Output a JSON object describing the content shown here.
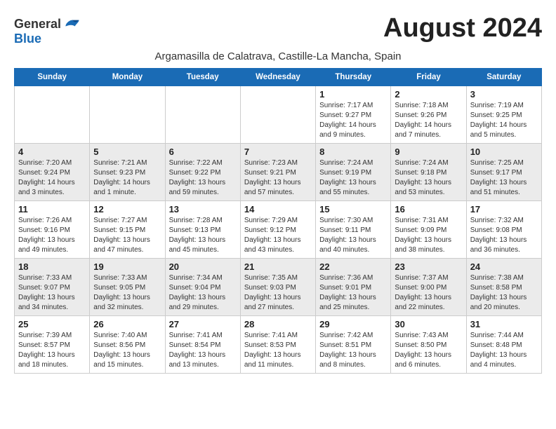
{
  "header": {
    "logo_general": "General",
    "logo_blue": "Blue",
    "title": "August 2024",
    "subtitle": "Argamasilla de Calatrava, Castille-La Mancha, Spain"
  },
  "days_of_week": [
    "Sunday",
    "Monday",
    "Tuesday",
    "Wednesday",
    "Thursday",
    "Friday",
    "Saturday"
  ],
  "weeks": [
    {
      "id": "week1",
      "cells": [
        {
          "day": "Sun",
          "date": "",
          "text": ""
        },
        {
          "day": "Mon",
          "date": "",
          "text": ""
        },
        {
          "day": "Tue",
          "date": "",
          "text": ""
        },
        {
          "day": "Wed",
          "date": "",
          "text": ""
        },
        {
          "day": "Thu",
          "date": "1",
          "text": "Sunrise: 7:17 AM\nSunset: 9:27 PM\nDaylight: 14 hours and 9 minutes."
        },
        {
          "day": "Fri",
          "date": "2",
          "text": "Sunrise: 7:18 AM\nSunset: 9:26 PM\nDaylight: 14 hours and 7 minutes."
        },
        {
          "day": "Sat",
          "date": "3",
          "text": "Sunrise: 7:19 AM\nSunset: 9:25 PM\nDaylight: 14 hours and 5 minutes."
        }
      ]
    },
    {
      "id": "week2",
      "cells": [
        {
          "day": "Sun",
          "date": "4",
          "text": "Sunrise: 7:20 AM\nSunset: 9:24 PM\nDaylight: 14 hours and 3 minutes."
        },
        {
          "day": "Mon",
          "date": "5",
          "text": "Sunrise: 7:21 AM\nSunset: 9:23 PM\nDaylight: 14 hours and 1 minute."
        },
        {
          "day": "Tue",
          "date": "6",
          "text": "Sunrise: 7:22 AM\nSunset: 9:22 PM\nDaylight: 13 hours and 59 minutes."
        },
        {
          "day": "Wed",
          "date": "7",
          "text": "Sunrise: 7:23 AM\nSunset: 9:21 PM\nDaylight: 13 hours and 57 minutes."
        },
        {
          "day": "Thu",
          "date": "8",
          "text": "Sunrise: 7:24 AM\nSunset: 9:19 PM\nDaylight: 13 hours and 55 minutes."
        },
        {
          "day": "Fri",
          "date": "9",
          "text": "Sunrise: 7:24 AM\nSunset: 9:18 PM\nDaylight: 13 hours and 53 minutes."
        },
        {
          "day": "Sat",
          "date": "10",
          "text": "Sunrise: 7:25 AM\nSunset: 9:17 PM\nDaylight: 13 hours and 51 minutes."
        }
      ]
    },
    {
      "id": "week3",
      "cells": [
        {
          "day": "Sun",
          "date": "11",
          "text": "Sunrise: 7:26 AM\nSunset: 9:16 PM\nDaylight: 13 hours and 49 minutes."
        },
        {
          "day": "Mon",
          "date": "12",
          "text": "Sunrise: 7:27 AM\nSunset: 9:15 PM\nDaylight: 13 hours and 47 minutes."
        },
        {
          "day": "Tue",
          "date": "13",
          "text": "Sunrise: 7:28 AM\nSunset: 9:13 PM\nDaylight: 13 hours and 45 minutes."
        },
        {
          "day": "Wed",
          "date": "14",
          "text": "Sunrise: 7:29 AM\nSunset: 9:12 PM\nDaylight: 13 hours and 43 minutes."
        },
        {
          "day": "Thu",
          "date": "15",
          "text": "Sunrise: 7:30 AM\nSunset: 9:11 PM\nDaylight: 13 hours and 40 minutes."
        },
        {
          "day": "Fri",
          "date": "16",
          "text": "Sunrise: 7:31 AM\nSunset: 9:09 PM\nDaylight: 13 hours and 38 minutes."
        },
        {
          "day": "Sat",
          "date": "17",
          "text": "Sunrise: 7:32 AM\nSunset: 9:08 PM\nDaylight: 13 hours and 36 minutes."
        }
      ]
    },
    {
      "id": "week4",
      "cells": [
        {
          "day": "Sun",
          "date": "18",
          "text": "Sunrise: 7:33 AM\nSunset: 9:07 PM\nDaylight: 13 hours and 34 minutes."
        },
        {
          "day": "Mon",
          "date": "19",
          "text": "Sunrise: 7:33 AM\nSunset: 9:05 PM\nDaylight: 13 hours and 32 minutes."
        },
        {
          "day": "Tue",
          "date": "20",
          "text": "Sunrise: 7:34 AM\nSunset: 9:04 PM\nDaylight: 13 hours and 29 minutes."
        },
        {
          "day": "Wed",
          "date": "21",
          "text": "Sunrise: 7:35 AM\nSunset: 9:03 PM\nDaylight: 13 hours and 27 minutes."
        },
        {
          "day": "Thu",
          "date": "22",
          "text": "Sunrise: 7:36 AM\nSunset: 9:01 PM\nDaylight: 13 hours and 25 minutes."
        },
        {
          "day": "Fri",
          "date": "23",
          "text": "Sunrise: 7:37 AM\nSunset: 9:00 PM\nDaylight: 13 hours and 22 minutes."
        },
        {
          "day": "Sat",
          "date": "24",
          "text": "Sunrise: 7:38 AM\nSunset: 8:58 PM\nDaylight: 13 hours and 20 minutes."
        }
      ]
    },
    {
      "id": "week5",
      "cells": [
        {
          "day": "Sun",
          "date": "25",
          "text": "Sunrise: 7:39 AM\nSunset: 8:57 PM\nDaylight: 13 hours and 18 minutes."
        },
        {
          "day": "Mon",
          "date": "26",
          "text": "Sunrise: 7:40 AM\nSunset: 8:56 PM\nDaylight: 13 hours and 15 minutes."
        },
        {
          "day": "Tue",
          "date": "27",
          "text": "Sunrise: 7:41 AM\nSunset: 8:54 PM\nDaylight: 13 hours and 13 minutes."
        },
        {
          "day": "Wed",
          "date": "28",
          "text": "Sunrise: 7:41 AM\nSunset: 8:53 PM\nDaylight: 13 hours and 11 minutes."
        },
        {
          "day": "Thu",
          "date": "29",
          "text": "Sunrise: 7:42 AM\nSunset: 8:51 PM\nDaylight: 13 hours and 8 minutes."
        },
        {
          "day": "Fri",
          "date": "30",
          "text": "Sunrise: 7:43 AM\nSunset: 8:50 PM\nDaylight: 13 hours and 6 minutes."
        },
        {
          "day": "Sat",
          "date": "31",
          "text": "Sunrise: 7:44 AM\nSunset: 8:48 PM\nDaylight: 13 hours and 4 minutes."
        }
      ]
    }
  ]
}
